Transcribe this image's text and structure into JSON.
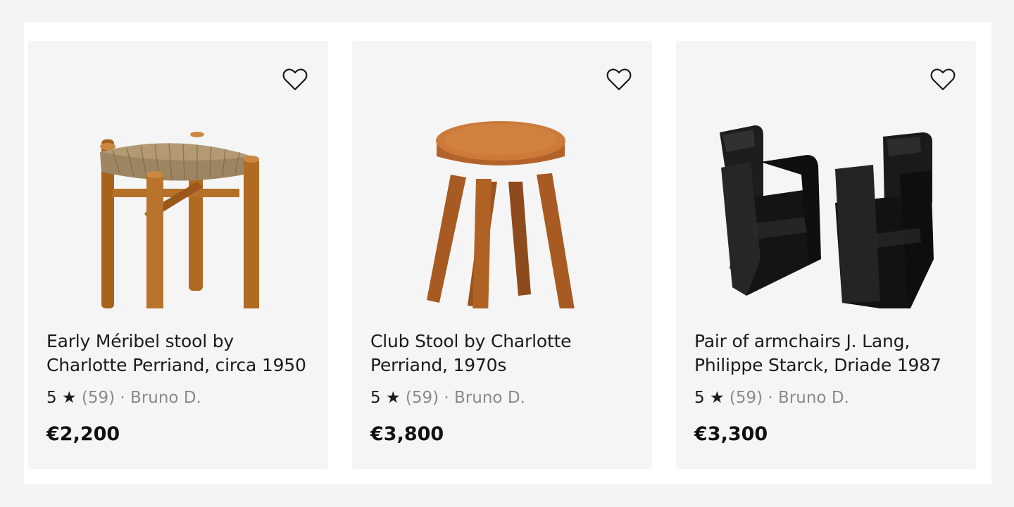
{
  "colors": {
    "page_background": "#f4f4f4",
    "panel_background": "#ffffff",
    "card_background": "#f5f5f5",
    "text_primary": "#1b1b1b",
    "text_muted": "#8a8a8a"
  },
  "products": [
    {
      "title": "Early Méribel stool by Charlotte Perriand, circa 1950",
      "rating": "5",
      "star": "★",
      "reviews": "(59)",
      "separator": "·",
      "seller": "Bruno D.",
      "price": "€2,200",
      "favorite_icon": "heart-outline-icon",
      "image_name": "rush-seat-stool-image"
    },
    {
      "title": "Club Stool by Charlotte Perriand, 1970s",
      "rating": "5",
      "star": "★",
      "reviews": "(59)",
      "separator": "·",
      "seller": "Bruno D.",
      "price": "€3,800",
      "favorite_icon": "heart-outline-icon",
      "image_name": "round-wood-stool-image"
    },
    {
      "title": "Pair of armchairs J. Lang, Philippe Starck, Driade 1987",
      "rating": "5",
      "star": "★",
      "reviews": "(59)",
      "separator": "·",
      "seller": "Bruno D.",
      "price": "€3,300",
      "favorite_icon": "heart-outline-icon",
      "image_name": "black-armchairs-image"
    }
  ]
}
